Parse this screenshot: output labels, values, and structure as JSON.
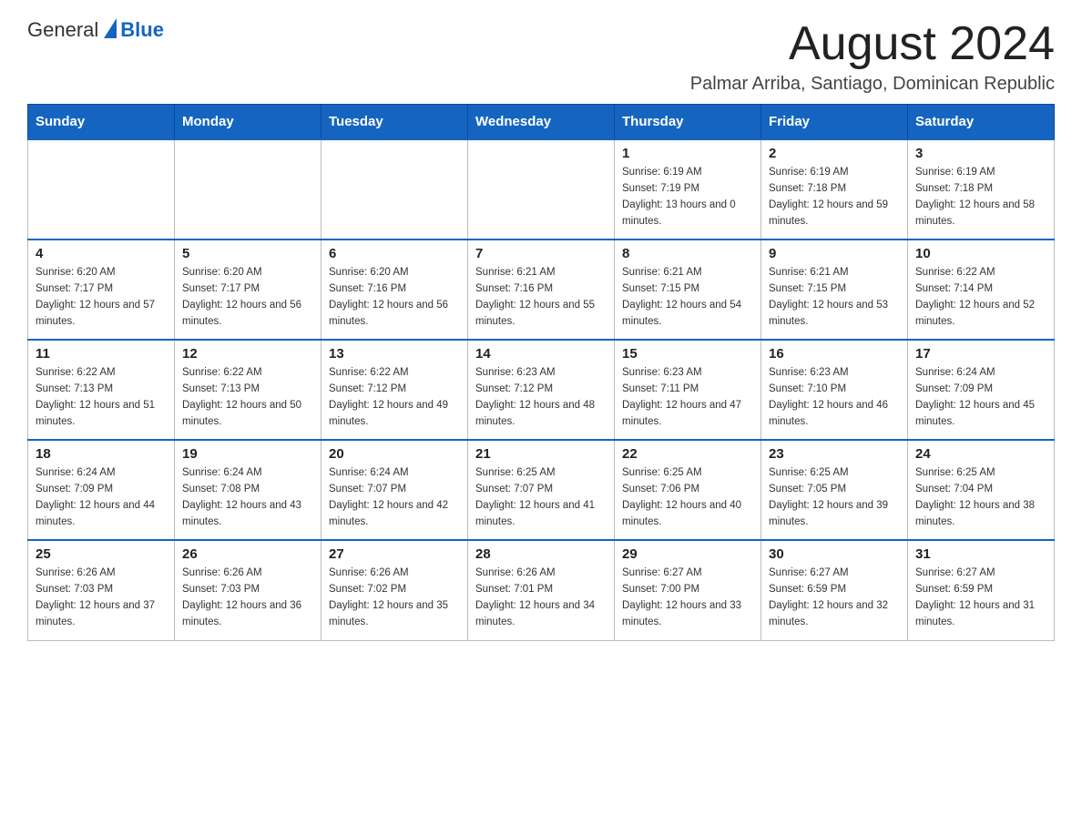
{
  "header": {
    "logo": {
      "general": "General",
      "blue": "Blue"
    },
    "title": "August 2024",
    "location": "Palmar Arriba, Santiago, Dominican Republic"
  },
  "weekdays": [
    "Sunday",
    "Monday",
    "Tuesday",
    "Wednesday",
    "Thursday",
    "Friday",
    "Saturday"
  ],
  "weeks": [
    [
      {
        "day": "",
        "info": ""
      },
      {
        "day": "",
        "info": ""
      },
      {
        "day": "",
        "info": ""
      },
      {
        "day": "",
        "info": ""
      },
      {
        "day": "1",
        "sunrise": "6:19 AM",
        "sunset": "7:19 PM",
        "daylight": "13 hours and 0 minutes."
      },
      {
        "day": "2",
        "sunrise": "6:19 AM",
        "sunset": "7:18 PM",
        "daylight": "12 hours and 59 minutes."
      },
      {
        "day": "3",
        "sunrise": "6:19 AM",
        "sunset": "7:18 PM",
        "daylight": "12 hours and 58 minutes."
      }
    ],
    [
      {
        "day": "4",
        "sunrise": "6:20 AM",
        "sunset": "7:17 PM",
        "daylight": "12 hours and 57 minutes."
      },
      {
        "day": "5",
        "sunrise": "6:20 AM",
        "sunset": "7:17 PM",
        "daylight": "12 hours and 56 minutes."
      },
      {
        "day": "6",
        "sunrise": "6:20 AM",
        "sunset": "7:16 PM",
        "daylight": "12 hours and 56 minutes."
      },
      {
        "day": "7",
        "sunrise": "6:21 AM",
        "sunset": "7:16 PM",
        "daylight": "12 hours and 55 minutes."
      },
      {
        "day": "8",
        "sunrise": "6:21 AM",
        "sunset": "7:15 PM",
        "daylight": "12 hours and 54 minutes."
      },
      {
        "day": "9",
        "sunrise": "6:21 AM",
        "sunset": "7:15 PM",
        "daylight": "12 hours and 53 minutes."
      },
      {
        "day": "10",
        "sunrise": "6:22 AM",
        "sunset": "7:14 PM",
        "daylight": "12 hours and 52 minutes."
      }
    ],
    [
      {
        "day": "11",
        "sunrise": "6:22 AM",
        "sunset": "7:13 PM",
        "daylight": "12 hours and 51 minutes."
      },
      {
        "day": "12",
        "sunrise": "6:22 AM",
        "sunset": "7:13 PM",
        "daylight": "12 hours and 50 minutes."
      },
      {
        "day": "13",
        "sunrise": "6:22 AM",
        "sunset": "7:12 PM",
        "daylight": "12 hours and 49 minutes."
      },
      {
        "day": "14",
        "sunrise": "6:23 AM",
        "sunset": "7:12 PM",
        "daylight": "12 hours and 48 minutes."
      },
      {
        "day": "15",
        "sunrise": "6:23 AM",
        "sunset": "7:11 PM",
        "daylight": "12 hours and 47 minutes."
      },
      {
        "day": "16",
        "sunrise": "6:23 AM",
        "sunset": "7:10 PM",
        "daylight": "12 hours and 46 minutes."
      },
      {
        "day": "17",
        "sunrise": "6:24 AM",
        "sunset": "7:09 PM",
        "daylight": "12 hours and 45 minutes."
      }
    ],
    [
      {
        "day": "18",
        "sunrise": "6:24 AM",
        "sunset": "7:09 PM",
        "daylight": "12 hours and 44 minutes."
      },
      {
        "day": "19",
        "sunrise": "6:24 AM",
        "sunset": "7:08 PM",
        "daylight": "12 hours and 43 minutes."
      },
      {
        "day": "20",
        "sunrise": "6:24 AM",
        "sunset": "7:07 PM",
        "daylight": "12 hours and 42 minutes."
      },
      {
        "day": "21",
        "sunrise": "6:25 AM",
        "sunset": "7:07 PM",
        "daylight": "12 hours and 41 minutes."
      },
      {
        "day": "22",
        "sunrise": "6:25 AM",
        "sunset": "7:06 PM",
        "daylight": "12 hours and 40 minutes."
      },
      {
        "day": "23",
        "sunrise": "6:25 AM",
        "sunset": "7:05 PM",
        "daylight": "12 hours and 39 minutes."
      },
      {
        "day": "24",
        "sunrise": "6:25 AM",
        "sunset": "7:04 PM",
        "daylight": "12 hours and 38 minutes."
      }
    ],
    [
      {
        "day": "25",
        "sunrise": "6:26 AM",
        "sunset": "7:03 PM",
        "daylight": "12 hours and 37 minutes."
      },
      {
        "day": "26",
        "sunrise": "6:26 AM",
        "sunset": "7:03 PM",
        "daylight": "12 hours and 36 minutes."
      },
      {
        "day": "27",
        "sunrise": "6:26 AM",
        "sunset": "7:02 PM",
        "daylight": "12 hours and 35 minutes."
      },
      {
        "day": "28",
        "sunrise": "6:26 AM",
        "sunset": "7:01 PM",
        "daylight": "12 hours and 34 minutes."
      },
      {
        "day": "29",
        "sunrise": "6:27 AM",
        "sunset": "7:00 PM",
        "daylight": "12 hours and 33 minutes."
      },
      {
        "day": "30",
        "sunrise": "6:27 AM",
        "sunset": "6:59 PM",
        "daylight": "12 hours and 32 minutes."
      },
      {
        "day": "31",
        "sunrise": "6:27 AM",
        "sunset": "6:59 PM",
        "daylight": "12 hours and 31 minutes."
      }
    ]
  ]
}
